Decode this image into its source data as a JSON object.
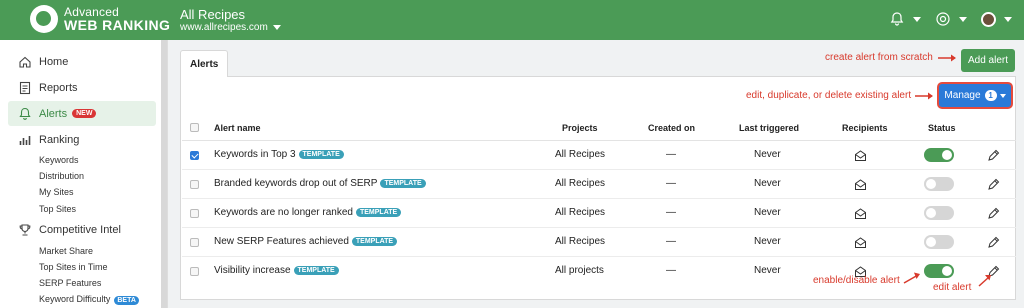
{
  "header": {
    "logo_line1": "Advanced",
    "logo_line2": "WEB RANKING",
    "project_name": "All Recipes",
    "project_url": "www.allrecipes.com"
  },
  "sidebar": {
    "items": [
      {
        "label": "Home",
        "icon": "home-icon"
      },
      {
        "label": "Reports",
        "icon": "reports-icon"
      },
      {
        "label": "Alerts",
        "icon": "bell-icon",
        "badge": "NEW",
        "active": true
      },
      {
        "label": "Ranking",
        "icon": "ranking-icon"
      },
      {
        "label": "Competitive Intel",
        "icon": "trophy-icon"
      }
    ],
    "ranking_sub": [
      "Keywords",
      "Distribution",
      "My Sites",
      "Top Sites"
    ],
    "intel_sub": [
      "Market Share",
      "Top Sites in Time",
      "SERP Features",
      "Keyword Difficulty"
    ],
    "beta_badge": "BETA"
  },
  "main": {
    "tab_label": "Alerts",
    "add_alert_label": "Add alert",
    "manage_label": "Manage",
    "manage_count": "1",
    "annotations": {
      "create": "create alert from scratch",
      "manage": "edit, duplicate, or delete existing alert",
      "toggle": "enable/disable alert",
      "edit": "edit alert"
    },
    "columns": [
      "Alert name",
      "Projects",
      "Created on",
      "Last triggered",
      "Recipients",
      "Status"
    ],
    "template_badge": "TEMPLATE",
    "rows": [
      {
        "name": "Keywords in Top 3",
        "project": "All Recipes",
        "created": "—",
        "triggered": "Never",
        "checked": true,
        "enabled": true
      },
      {
        "name": "Branded keywords drop out of SERP",
        "project": "All Recipes",
        "created": "—",
        "triggered": "Never",
        "checked": false,
        "enabled": false
      },
      {
        "name": "Keywords are no longer ranked",
        "project": "All Recipes",
        "created": "—",
        "triggered": "Never",
        "checked": false,
        "enabled": false
      },
      {
        "name": "New SERP Features achieved",
        "project": "All Recipes",
        "created": "—",
        "triggered": "Never",
        "checked": false,
        "enabled": false
      },
      {
        "name": "Visibility increase",
        "project": "All projects",
        "created": "—",
        "triggered": "Never",
        "checked": false,
        "enabled": true
      }
    ]
  },
  "colors": {
    "brand_green": "#4b9b56",
    "accent_blue": "#2a7ad8",
    "annotation_red": "#d83a2c",
    "template_teal": "#3aa0b8"
  }
}
